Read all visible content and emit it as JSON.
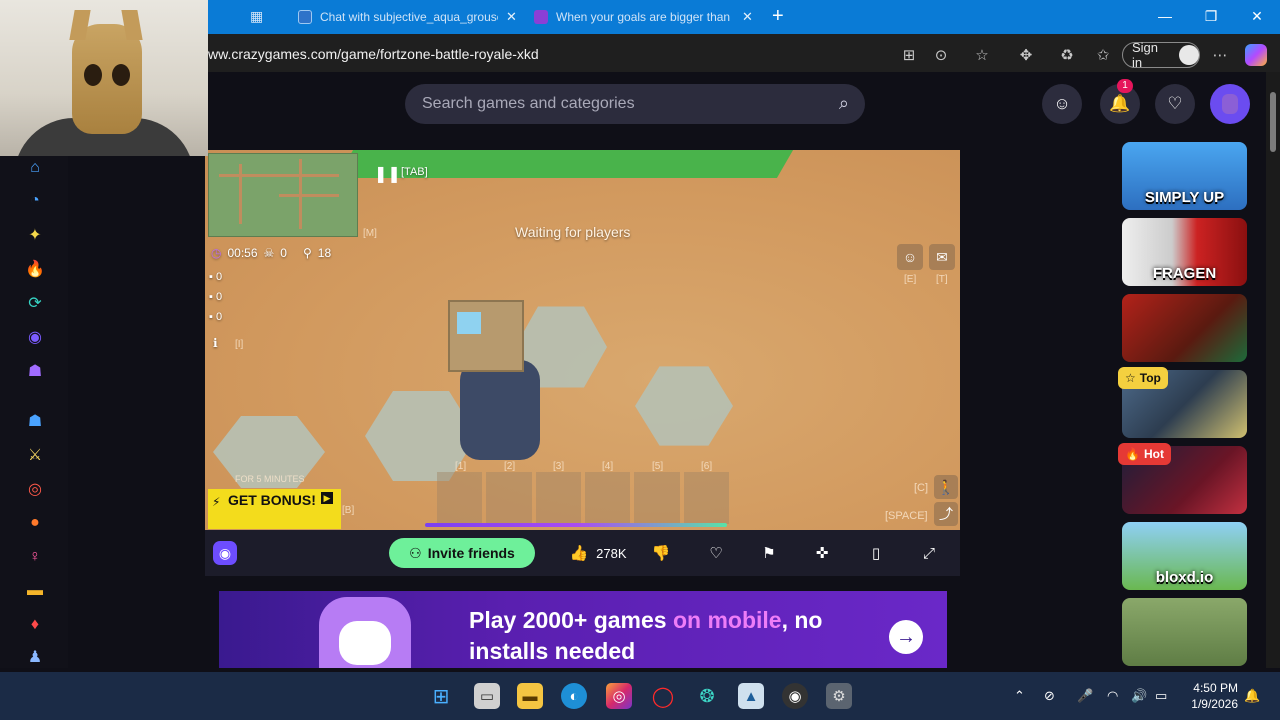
{
  "browser": {
    "tabs": [
      {
        "label": "Chat with subjective_aqua_grouse",
        "close": "✕"
      },
      {
        "label": "When your goals are bigger than",
        "close": "✕"
      }
    ],
    "new_tab": "+",
    "window_controls": {
      "minimize": "—",
      "restore": "❐",
      "close": "✕"
    },
    "url": "ww.crazygames.com/game/fortzone-battle-royale-xkd",
    "sign_in_label": "Sign in",
    "more": "⋯"
  },
  "site": {
    "search_placeholder": "Search games and categories",
    "notification_count": "1",
    "header_icons": [
      "friends-icon",
      "bell-icon",
      "heart-icon",
      "avatar"
    ]
  },
  "sidebar": {
    "items": [
      {
        "icon": "home-icon",
        "glyph": "⌂",
        "color": "#4aa3ff"
      },
      {
        "icon": "clock-icon",
        "glyph": "◔",
        "color": "#4aa3ff"
      },
      {
        "icon": "sparkle-icon",
        "glyph": "✦",
        "color": "#f5d84a"
      },
      {
        "icon": "flame-icon",
        "glyph": "🔥",
        "color": "#ff6a2b"
      },
      {
        "icon": "refresh-icon",
        "glyph": "⟳",
        "color": "#36d4c4"
      },
      {
        "icon": "crazygames-icon",
        "glyph": "◉",
        "color": "#7b5cff"
      },
      {
        "icon": "multiplayer-icon",
        "glyph": "☗",
        "color": "#a16cff"
      },
      {
        "icon": "two-player-icon",
        "glyph": "☗",
        "color": "#4aa3ff"
      },
      {
        "icon": "sword-icon",
        "glyph": "⚔",
        "color": "#f0d060"
      },
      {
        "icon": "compass-icon",
        "glyph": "◎",
        "color": "#ff5a4a"
      },
      {
        "icon": "basketball-icon",
        "glyph": "●",
        "color": "#ff7a2b"
      },
      {
        "icon": "dress-icon",
        "glyph": "♀",
        "color": "#ff5aa0"
      },
      {
        "icon": "car-icon",
        "glyph": "▬",
        "color": "#f5b52a"
      },
      {
        "icon": "cards-icon",
        "glyph": "♦",
        "color": "#ff4a4a"
      },
      {
        "icon": "pawn-icon",
        "glyph": "♟",
        "color": "#8ab8ff"
      }
    ]
  },
  "game": {
    "pause_hint": "[TAB]",
    "map_hint": "[M]",
    "status": "Waiting for players",
    "timer": "00:56",
    "kills": "0",
    "players": "18",
    "resources": [
      "0",
      "0",
      "0"
    ],
    "info_hint": "[I]",
    "emote_hints": [
      "[E]",
      "[T]"
    ],
    "slot_keys": [
      "[1]",
      "[2]",
      "[3]",
      "[4]",
      "[5]",
      "[6]"
    ],
    "bonus_label": "GET BONUS!",
    "bonus_sub": "FOR 5 MINUTES",
    "bonus_key": "[B]",
    "crouch_key": "[C]",
    "jump_key": "[SPACE]"
  },
  "toolbar": {
    "invite_label": "Invite friends",
    "likes": "278K"
  },
  "promo": {
    "text_a": "Play 2000+ games ",
    "text_highlight": "on mobile",
    "text_b": ", no installs needed",
    "arrow": "→"
  },
  "thumbnails": [
    {
      "label": "SIMPLY UP",
      "bg": "#3f8ad8"
    },
    {
      "label": "FRAGEN",
      "bg": "#b3232a"
    },
    {
      "label": "",
      "bg": "#8a2a1a"
    },
    {
      "label": "",
      "bg": "#3b4e66",
      "badge": "Top"
    },
    {
      "label": "",
      "bg": "#5a1f2b",
      "badge": "Hot"
    },
    {
      "label": "bloxd.io",
      "bg": "#7fc7ef"
    },
    {
      "label": "",
      "bg": "#6b8a52"
    }
  ],
  "taskbar": {
    "time": "4:50 PM",
    "date": "1/9/2026"
  }
}
